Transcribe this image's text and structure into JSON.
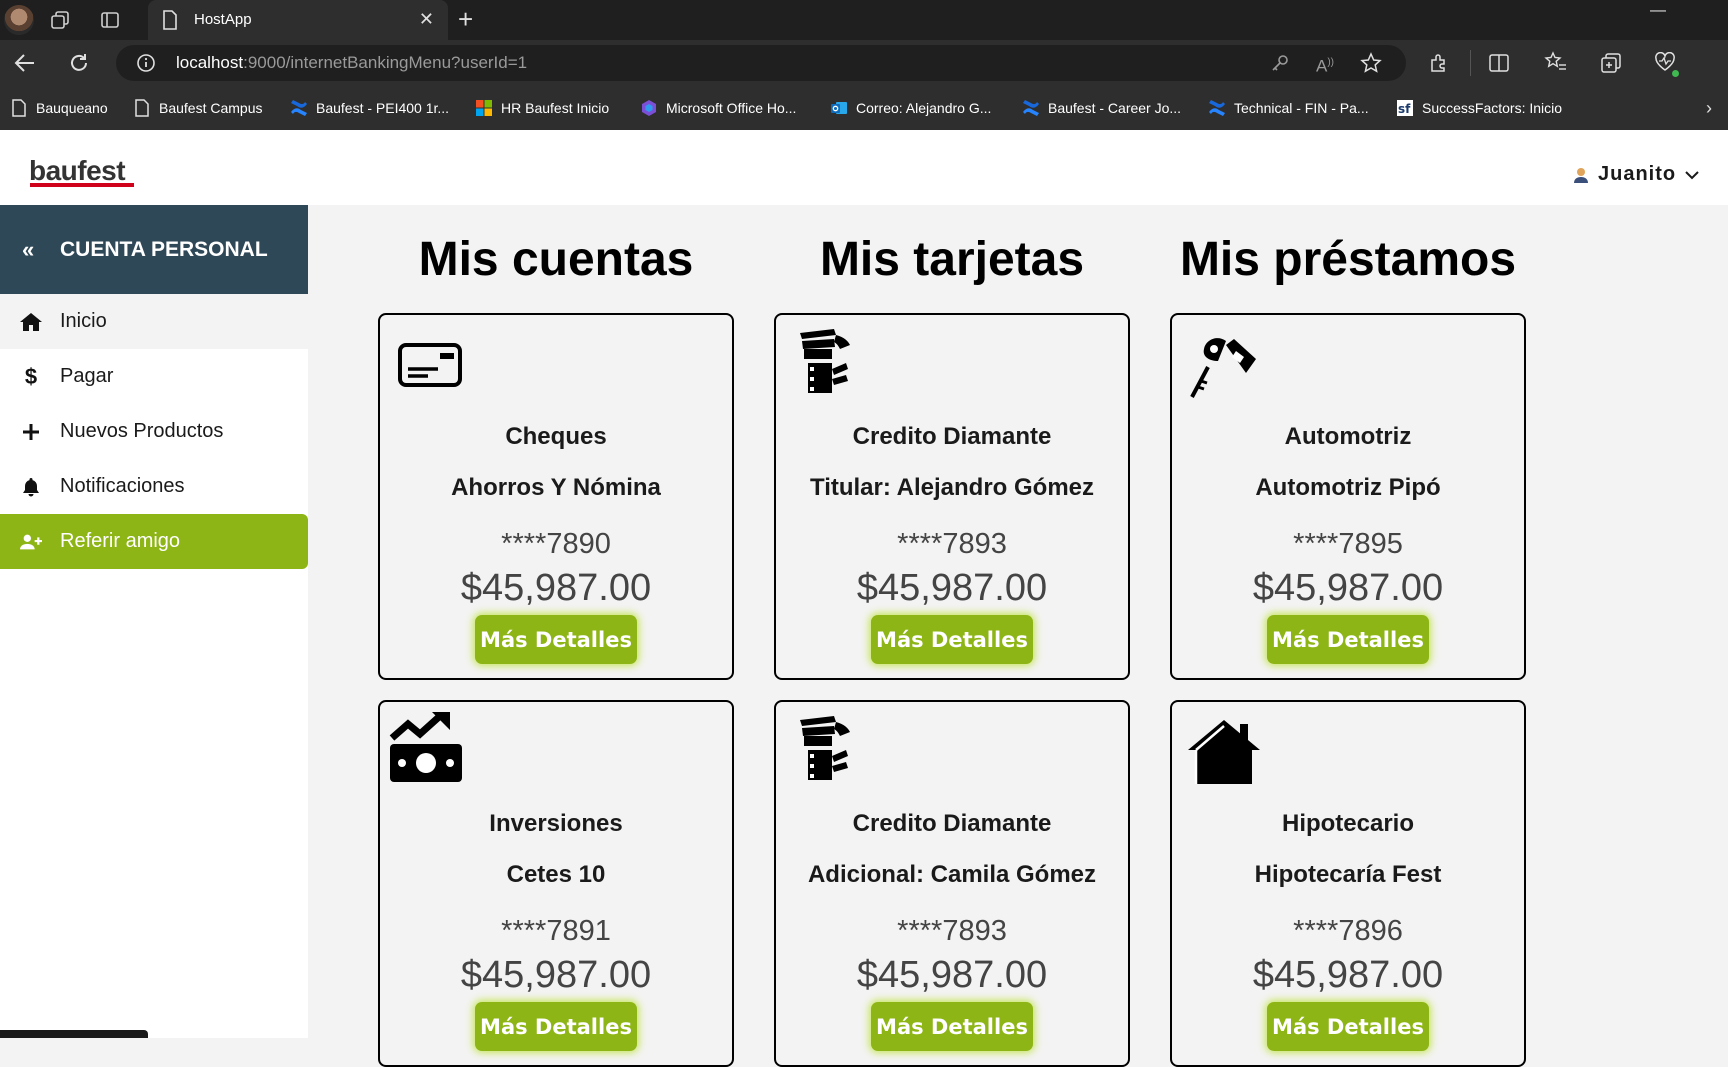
{
  "browser": {
    "tab_title": "HostApp",
    "tab_close": "✕",
    "new_tab": "+",
    "url_host": "localhost",
    "url_rest": ":9000/internetBankingMenu?userId=1",
    "bookmarks": [
      {
        "label": "Bauqueano",
        "icon": "page-icon"
      },
      {
        "label": "Baufest Campus",
        "icon": "page-icon"
      },
      {
        "label": "Baufest - PEI400 1r...",
        "icon": "confluence-icon"
      },
      {
        "label": "HR Baufest Inicio",
        "icon": "microsoft-icon"
      },
      {
        "label": "Microsoft Office Ho...",
        "icon": "office-icon"
      },
      {
        "label": "Correo: Alejandro G...",
        "icon": "outlook-icon"
      },
      {
        "label": "Baufest - Career Jo...",
        "icon": "confluence-icon"
      },
      {
        "label": "Technical - FIN - Pa...",
        "icon": "confluence-icon"
      },
      {
        "label": "SuccessFactors: Inicio",
        "icon": "successfactors-icon"
      }
    ]
  },
  "header": {
    "logo": "baufest",
    "user_name": "Juanito"
  },
  "sidebar": {
    "title": "CUENTA PERSONAL",
    "collapse_icon": "«",
    "items": [
      {
        "label": "Inicio",
        "icon": "home-icon"
      },
      {
        "label": "Pagar",
        "icon": "dollar-icon"
      },
      {
        "label": "Nuevos Productos",
        "icon": "plus-icon"
      },
      {
        "label": "Notificaciones",
        "icon": "bell-icon"
      },
      {
        "label": "Referir amigo",
        "icon": "add-user-icon"
      }
    ]
  },
  "main": {
    "columns": [
      {
        "title": "Mis cuentas"
      },
      {
        "title": "Mis tarjetas"
      },
      {
        "title": "Mis préstamos"
      }
    ],
    "cards": [
      {
        "type": "Cheques",
        "name": "Ahorros Y Nómina",
        "number": "****7890",
        "amount": "$45,987.00",
        "button": "Más Detalles",
        "icon": "credit-card-icon"
      },
      {
        "type": "Credito Diamante",
        "name": "Titular: Alejandro Gómez",
        "number": "****7893",
        "amount": "$45,987.00",
        "button": "Más Detalles",
        "icon": "money-hand-icon"
      },
      {
        "type": "Automotriz",
        "name": "Automotriz Pipó",
        "number": "****7895",
        "amount": "$45,987.00",
        "button": "Más Detalles",
        "icon": "car-key-icon"
      },
      {
        "type": "Inversiones",
        "name": "Cetes 10",
        "number": "****7891",
        "amount": "$45,987.00",
        "button": "Más Detalles",
        "icon": "money-growth-icon"
      },
      {
        "type": "Credito Diamante",
        "name": "Adicional: Camila Gómez",
        "number": "****7893",
        "amount": "$45,987.00",
        "button": "Más Detalles",
        "icon": "money-hand-icon"
      },
      {
        "type": "Hipotecario",
        "name": "Hipotecaría Fest",
        "number": "****7896",
        "amount": "$45,987.00",
        "button": "Más Detalles",
        "icon": "house-icon"
      }
    ]
  },
  "colors": {
    "accent_green": "#8db516",
    "sidebar_header": "#2f4858",
    "logo_red": "#d0021b"
  }
}
